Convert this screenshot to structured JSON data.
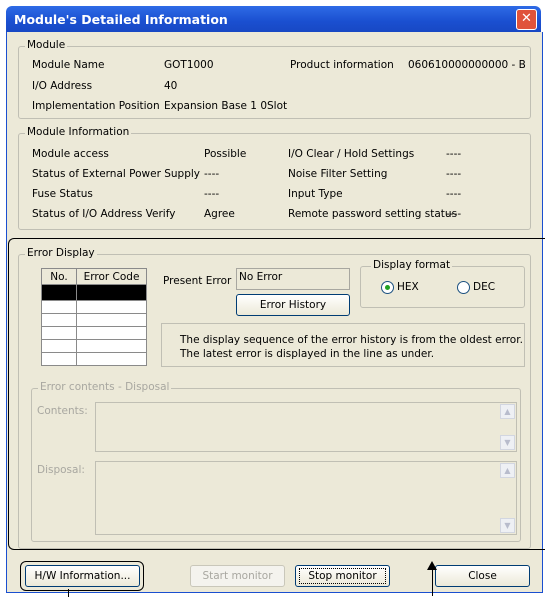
{
  "window": {
    "title": "Module's Detailed Information",
    "close_icon": "close-icon"
  },
  "module": {
    "group_label": "Module",
    "name_label": "Module Name",
    "name_value": "GOT1000",
    "product_label": "Product information",
    "product_value": "060610000000000 - B",
    "io_label": "I/O Address",
    "io_value": "40",
    "impl_label": "Implementation Position",
    "impl_value": "Expansion Base 1  0Slot"
  },
  "module_info": {
    "group_label": "Module Information",
    "rows": [
      {
        "l1": "Module access",
        "v1": "Possible",
        "l2": "I/O Clear / Hold Settings",
        "v2": "----"
      },
      {
        "l1": "Status of External Power Supply",
        "v1": "----",
        "l2": "Noise Filter Setting",
        "v2": "----"
      },
      {
        "l1": "Fuse Status",
        "v1": "----",
        "l2": "Input Type",
        "v2": "----"
      },
      {
        "l1": "Status of I/O Address Verify",
        "v1": "Agree",
        "l2": "Remote password setting status",
        "v2": "----"
      }
    ]
  },
  "error_display": {
    "group_label": "Error Display",
    "col_no": "No.",
    "col_code": "Error Code",
    "present_error_label": "Present Error",
    "present_error_value": "No Error",
    "history_button": "Error History",
    "format_label": "Display format",
    "hex_label": "HEX",
    "dec_label": "DEC",
    "selected_format": "HEX",
    "message_line1": "The display sequence of the error history is from the oldest error.",
    "message_line2": "The latest error is displayed in the line as under."
  },
  "error_contents": {
    "group_label": "Error contents - Disposal",
    "contents_label": "Contents:",
    "disposal_label": "Disposal:"
  },
  "buttons": {
    "hw_info": "H/W Information...",
    "start_monitor": "Start monitor",
    "stop_monitor": "Stop monitor",
    "close": "Close"
  }
}
